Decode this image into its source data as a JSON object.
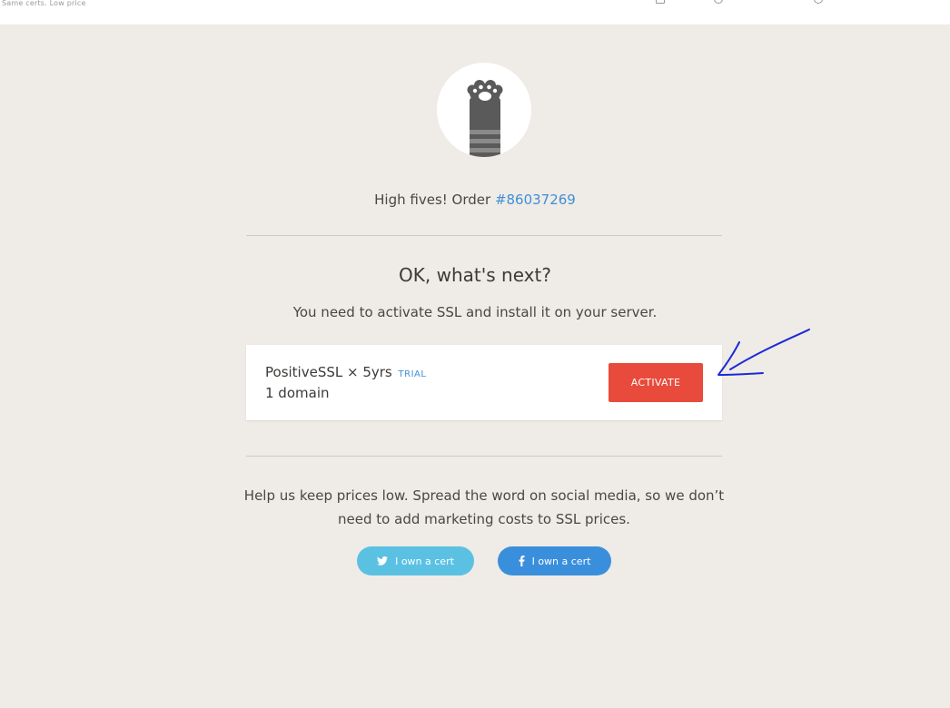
{
  "header": {
    "tagline": "Same certs. Low price"
  },
  "order": {
    "prefix": "High fives! Order ",
    "number": "#86037269"
  },
  "next": {
    "title": "OK, what's next?",
    "description": "You need to activate SSL and install it on your server."
  },
  "cert": {
    "name": "PositiveSSL × 5yrs",
    "badge": "TRIAL",
    "domains": "1 domain",
    "activate_label": "ACTIVATE"
  },
  "share": {
    "message": "Help us keep prices low. Spread the word on social media, so we don’t need to add marketing costs to SSL prices.",
    "twitter_label": "I own a cert",
    "facebook_label": "I own a cert"
  },
  "colors": {
    "background": "#efebe6",
    "link": "#3f8fd8",
    "activate": "#e84b3b",
    "twitter": "#5bc1e3",
    "facebook": "#3a8fdc",
    "annotation": "#1a2ad8"
  }
}
